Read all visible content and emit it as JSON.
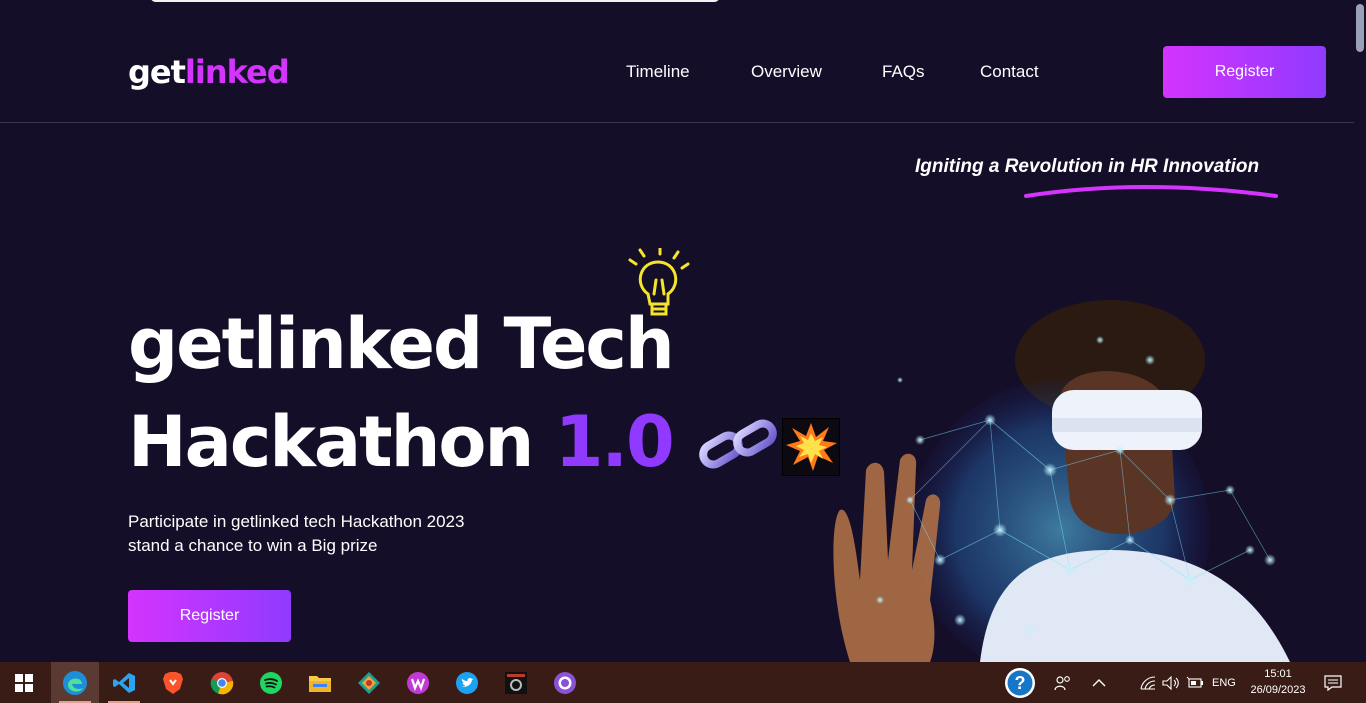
{
  "brand": {
    "part1": "get",
    "part2": "linked"
  },
  "nav": {
    "links": [
      "Timeline",
      "Overview",
      "FAQs",
      "Contact"
    ],
    "register_label": "Register"
  },
  "hero": {
    "tagline": "Igniting a Revolution in HR Innovation",
    "title_line1": "getlinked Tech",
    "title_line2": "Hackathon",
    "version": "1.0",
    "description": "Participate in getlinked tech Hackathon 2023 stand a chance to win a Big prize",
    "register_label": "Register"
  },
  "taskbar": {
    "apps": [
      "windows-start",
      "edge",
      "vscode",
      "brave",
      "chrome",
      "spotify",
      "file-explorer",
      "gitkraken",
      "wps-office",
      "twitter",
      "game-app",
      "github-desktop"
    ],
    "language": "ENG",
    "time": "15:01",
    "date": "26/09/2023"
  },
  "colors": {
    "background": "#150e28",
    "accent_pink": "#d434fe",
    "accent_purple": "#903aff",
    "taskbar": "#3a1c16"
  }
}
